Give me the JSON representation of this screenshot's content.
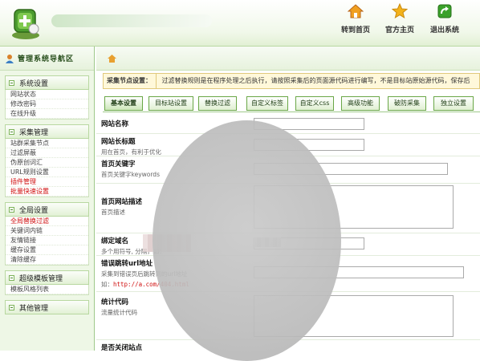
{
  "header": {
    "nav": [
      {
        "label": "转到首页",
        "icon": "home-icon"
      },
      {
        "label": "官方主页",
        "icon": "star-icon"
      },
      {
        "label": "退出系统",
        "icon": "exit-icon"
      }
    ]
  },
  "sidebar": {
    "title": "管理系统导航区",
    "groups": [
      {
        "title": "系统设置",
        "items": [
          {
            "label": "网站状态"
          },
          {
            "label": "修改密码"
          },
          {
            "label": "在线升级"
          }
        ]
      },
      {
        "title": "采集管理",
        "items": [
          {
            "label": "站群采集节点"
          },
          {
            "label": "过滤屏蔽"
          },
          {
            "label": "伪原创词汇"
          },
          {
            "label": "URL规则设置"
          },
          {
            "label": "插件管理",
            "red": true
          },
          {
            "label": "批量快速设置",
            "red": true
          }
        ]
      },
      {
        "title": "全局设置",
        "items": [
          {
            "label": "全局替换过滤",
            "red": true
          },
          {
            "label": "关键词内链"
          },
          {
            "label": "友情链接"
          },
          {
            "label": "缓存设置"
          },
          {
            "label": "清除缓存"
          }
        ]
      },
      {
        "title": "超级模板管理",
        "items": [
          {
            "label": "模板风格列表"
          }
        ]
      },
      {
        "title": "其他管理",
        "items": []
      }
    ]
  },
  "main": {
    "infobar": {
      "label": "采集节点设置：",
      "text": "过滤替换规则是在程序处理之后执行，请按照采集后的页面源代码进行编写，不是目标站原始源代码，保存后"
    },
    "tabs": [
      {
        "label": "基本设置"
      },
      {
        "label": "目标站设置"
      },
      {
        "label": "替换过滤"
      },
      {
        "label": "自定义标签"
      },
      {
        "label": "自定义css"
      },
      {
        "label": "高级功能"
      },
      {
        "label": "破防采集"
      },
      {
        "label": "独立设置"
      }
    ],
    "fields": [
      {
        "label": "网站名称",
        "desc": ""
      },
      {
        "label": "网站长标题",
        "desc": "用在首页，有利于优化"
      },
      {
        "label": "首页关键字",
        "desc": "首页关键字keywords"
      },
      {
        "label": "首页网站描述",
        "desc": "首页描述"
      },
      {
        "label": "绑定域名",
        "desc": "多个用符号, 分隔，如："
      },
      {
        "label": "错误跳转url地址",
        "desc": "采集到错误页后跳转到的url地址",
        "example_label": "如：",
        "example": "http://a.com/404.html"
      },
      {
        "label": "统计代码",
        "desc": "流量统计代码"
      },
      {
        "label": "是否关闭站点",
        "desc": ""
      }
    ]
  },
  "colors": {
    "accent_green": "#6aa747",
    "sidebar_bg": "#eef7e6",
    "info_bg": "#fff8da",
    "red_text": "#d01010"
  }
}
